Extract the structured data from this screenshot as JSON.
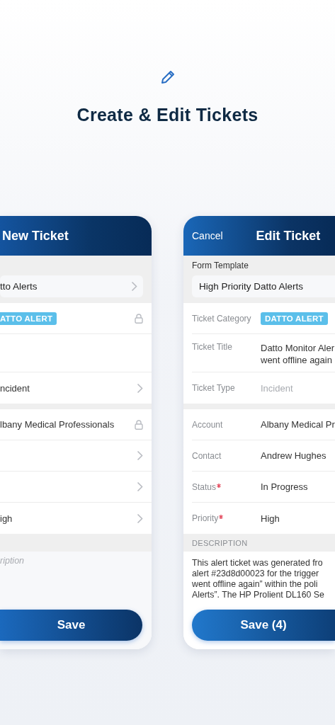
{
  "heading": "Create & Edit Tickets",
  "left_screen": {
    "title": "New Ticket",
    "template_value": "tto Alerts",
    "sections": [
      [
        {
          "kind": "badge",
          "value": "ATTO ALERT",
          "locked": true,
          "disclosure": false
        },
        {
          "kind": "empty",
          "locked": false,
          "disclosure": false
        },
        {
          "kind": "text",
          "value": "ncident",
          "locked": false,
          "disclosure": true
        }
      ],
      [
        {
          "kind": "text",
          "value": "lbany Medical Professionals",
          "locked": true,
          "disclosure": false
        },
        {
          "kind": "empty",
          "locked": false,
          "disclosure": true
        },
        {
          "kind": "empty",
          "locked": false,
          "disclosure": true
        },
        {
          "kind": "text",
          "value": "igh",
          "locked": false,
          "disclosure": true
        }
      ]
    ],
    "description_placeholder": "ription",
    "save_button": "Save"
  },
  "right_screen": {
    "cancel": "Cancel",
    "title": "Edit Ticket",
    "template_label": "Form Template",
    "template_value": "High Priority Datto Alerts",
    "sections": [
      [
        {
          "label": "Ticket Category",
          "kind": "badge",
          "value": "DATTO ALERT",
          "required": false
        },
        {
          "label": "Ticket Title",
          "kind": "multiline",
          "lines": [
            "Datto Monitor Aler",
            "went offline again"
          ],
          "required": false
        },
        {
          "label": "Ticket Type",
          "kind": "muted",
          "value": "Incident",
          "required": false
        }
      ],
      [
        {
          "label": "Account",
          "kind": "text",
          "value": "Albany Medical Pr",
          "required": false
        },
        {
          "label": "Contact",
          "kind": "text",
          "value": "Andrew Hughes",
          "required": false
        },
        {
          "label": "Status",
          "kind": "text",
          "value": "In Progress",
          "required": true
        },
        {
          "label": "Priority",
          "kind": "text",
          "value": "High",
          "required": true
        }
      ]
    ],
    "description_label": "DESCRIPTION",
    "description_lines": [
      "This alert ticket was generated fro",
      "alert #23d8d00023 for the trigger",
      "went offline again” within the poli",
      "Alerts”. The HP Prolient DL160 Se"
    ],
    "save_button": "Save (4)"
  }
}
